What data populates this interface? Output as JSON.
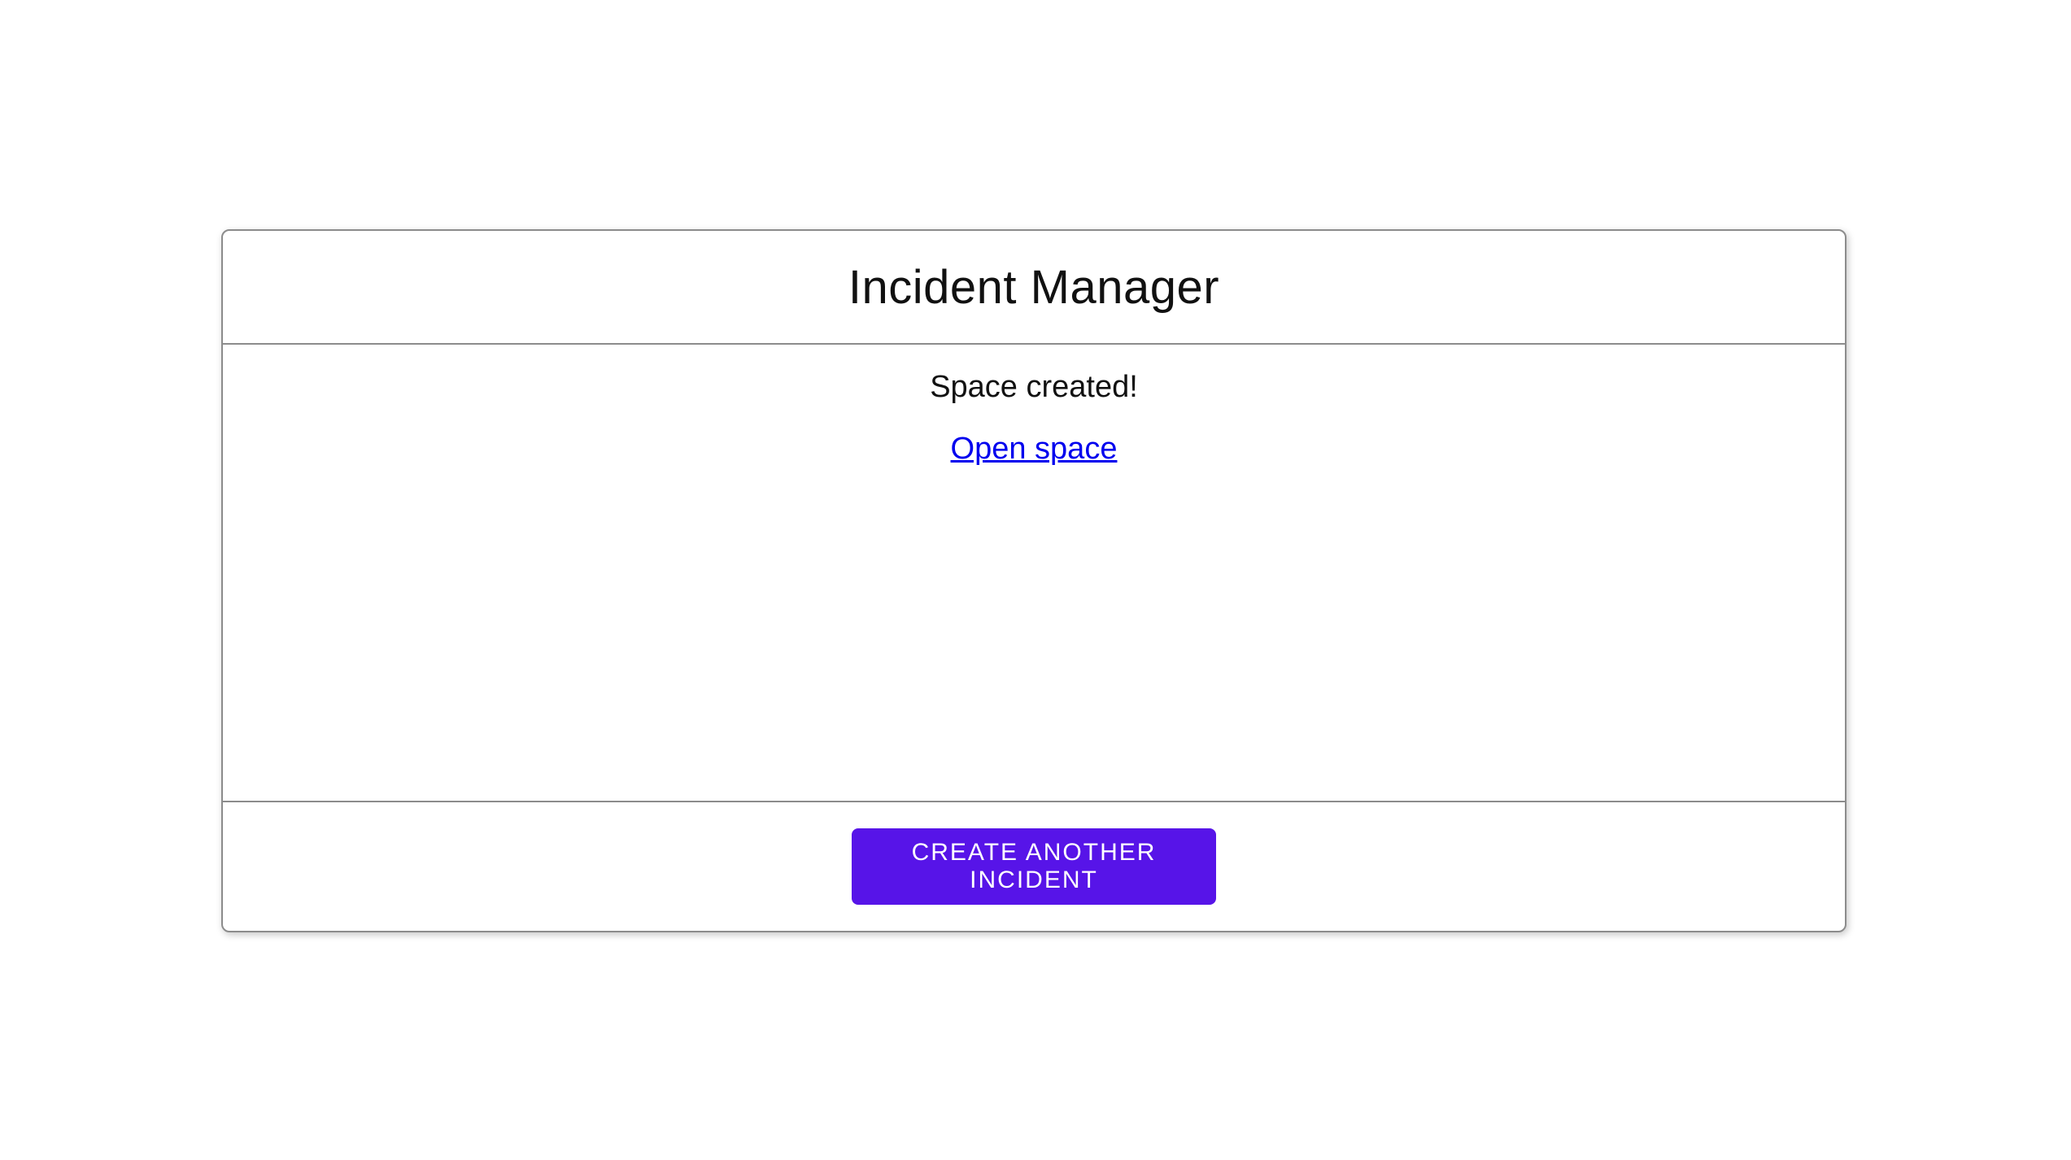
{
  "app": {
    "title": "Incident Manager"
  },
  "content": {
    "status_message": "Space created!",
    "link_label": "Open space"
  },
  "footer": {
    "create_button_label": "CREATE ANOTHER INCIDENT"
  },
  "colors": {
    "primary": "#5714e8",
    "link": "#0000ee",
    "border": "#8c8c8c",
    "text": "#111111"
  }
}
